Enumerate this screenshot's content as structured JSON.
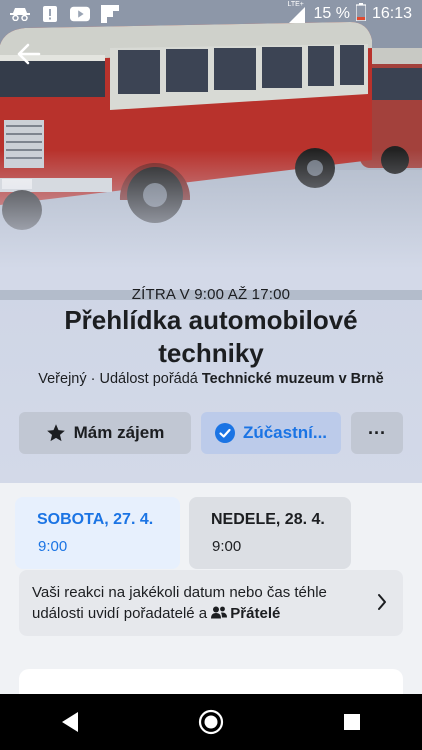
{
  "status_bar": {
    "icons_left": [
      "incognito-icon",
      "alert-icon",
      "youtube-icon",
      "flipboard-icon"
    ],
    "network": "LTE+",
    "battery": "15 %",
    "time": "16:13"
  },
  "event": {
    "time": "ZÍTRA V 9:00 AŽ 17:00",
    "title": "Přehlídka automobilové techniky",
    "privacy": "Veřejný · Událost pořádá ",
    "host": "Technické muzeum v Brně"
  },
  "actions": {
    "interested": "Mám zájem",
    "going": "Zúčastní...",
    "more": "···"
  },
  "dates": [
    {
      "day": "SOBOTA, 27. 4.",
      "time": "9:00",
      "selected": true
    },
    {
      "day": "NEDELE, 28. 4.",
      "time": "9:00",
      "selected": false
    }
  ],
  "notice": {
    "text": "Vaši reakci na jakékoli datum nebo čas téhle události uvidí pořadatelé a ",
    "audience": "Přátelé"
  },
  "colors": {
    "accent": "#1b74e4",
    "bus_red": "#b8322c"
  }
}
